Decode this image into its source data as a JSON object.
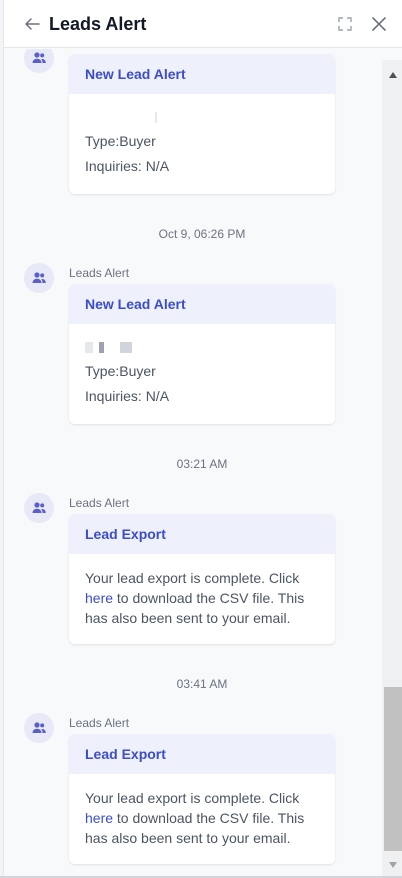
{
  "header": {
    "title": "Leads Alert"
  },
  "icons": {
    "back": "arrow-left-icon",
    "expand": "expand-icon",
    "close": "close-icon",
    "avatar": "users-icon"
  },
  "colors": {
    "accent": "#3b4dc8",
    "card_header_bg": "#eef0fc",
    "avatar_bg": "#e7e9f6",
    "avatar_icon": "#5b5fc7"
  },
  "messages": [
    {
      "title": "New Lead Alert",
      "lines": [
        "Type:Buyer",
        "Inquiries: N/A"
      ]
    },
    {
      "timestamp": "Oct 9, 06:26 PM",
      "sender": "Leads Alert",
      "title": "New Lead Alert",
      "lines": [
        "Type:Buyer",
        "Inquiries: N/A"
      ]
    },
    {
      "timestamp": "03:21 AM",
      "sender": "Leads Alert",
      "title": "Lead Export",
      "text_before": "Your lead export is complete. Click ",
      "link": "here",
      "text_after": " to download the CSV file. This has also been sent to your email."
    },
    {
      "timestamp": "03:41 AM",
      "sender": "Leads Alert",
      "title": "Lead Export",
      "text_before": "Your lead export is complete. Click ",
      "link": "here",
      "text_after": " to download the CSV file. This has also been sent to your email."
    }
  ]
}
